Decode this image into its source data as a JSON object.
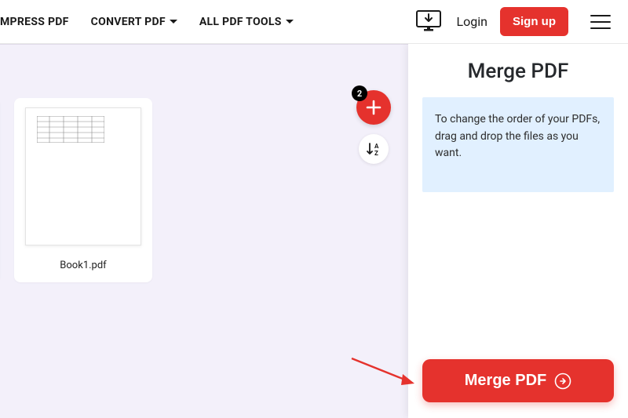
{
  "header": {
    "nav": [
      {
        "label": "MPRESS PDF",
        "has_dropdown": false
      },
      {
        "label": "CONVERT PDF",
        "has_dropdown": true
      },
      {
        "label": "ALL PDF TOOLS",
        "has_dropdown": true
      }
    ],
    "login_label": "Login",
    "signup_label": "Sign up"
  },
  "workspace": {
    "files": [
      {
        "name": "",
        "partial": true
      },
      {
        "name": "Book1.pdf",
        "partial": false
      }
    ],
    "add_badge_count": "2"
  },
  "sidebar": {
    "title": "Merge PDF",
    "info_text": "To change the order of your PDFs, drag and drop the files as you want.",
    "action_label": "Merge PDF"
  },
  "colors": {
    "accent": "#e5322d",
    "info_bg": "#e1f0ff",
    "workspace_bg": "#f3f0fa"
  }
}
